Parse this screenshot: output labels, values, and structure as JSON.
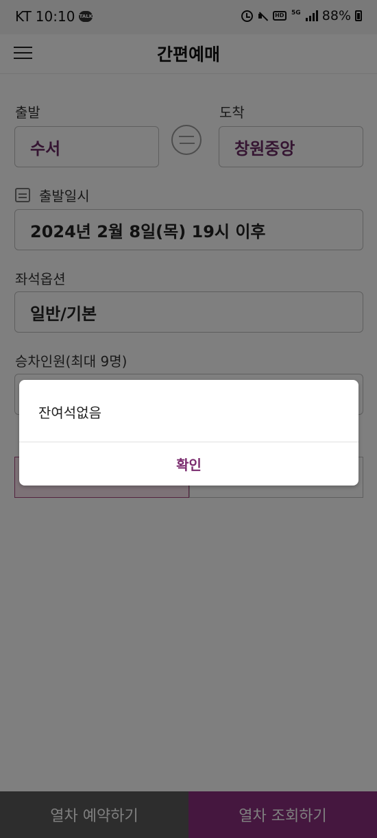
{
  "status_bar": {
    "carrier": "KT",
    "time": "10:10",
    "talk_badge": "TALK",
    "hd_badge": "HD",
    "network": "5G",
    "battery": "88%"
  },
  "header": {
    "title": "간편예매"
  },
  "route": {
    "departure_label": "출발",
    "departure_value": "수서",
    "arrival_label": "도착",
    "arrival_value": "창원중앙"
  },
  "datetime": {
    "label": "출발일시",
    "value": "2024년 2월 8일(목) 19시 이후"
  },
  "seat_option": {
    "label": "좌석옵션",
    "value": "일반/기본"
  },
  "passengers": {
    "label": "승차인원(최대 9명)"
  },
  "bottom_bar": {
    "reserve_label": "열차 예약하기",
    "search_label": "열차 조회하기"
  },
  "dialog": {
    "message": "잔여석없음",
    "confirm_label": "확인"
  },
  "colors": {
    "accent": "#7a2b6e",
    "station_text": "#6b2a64",
    "dim_overlay": "rgba(0,0,0,0.5)"
  }
}
